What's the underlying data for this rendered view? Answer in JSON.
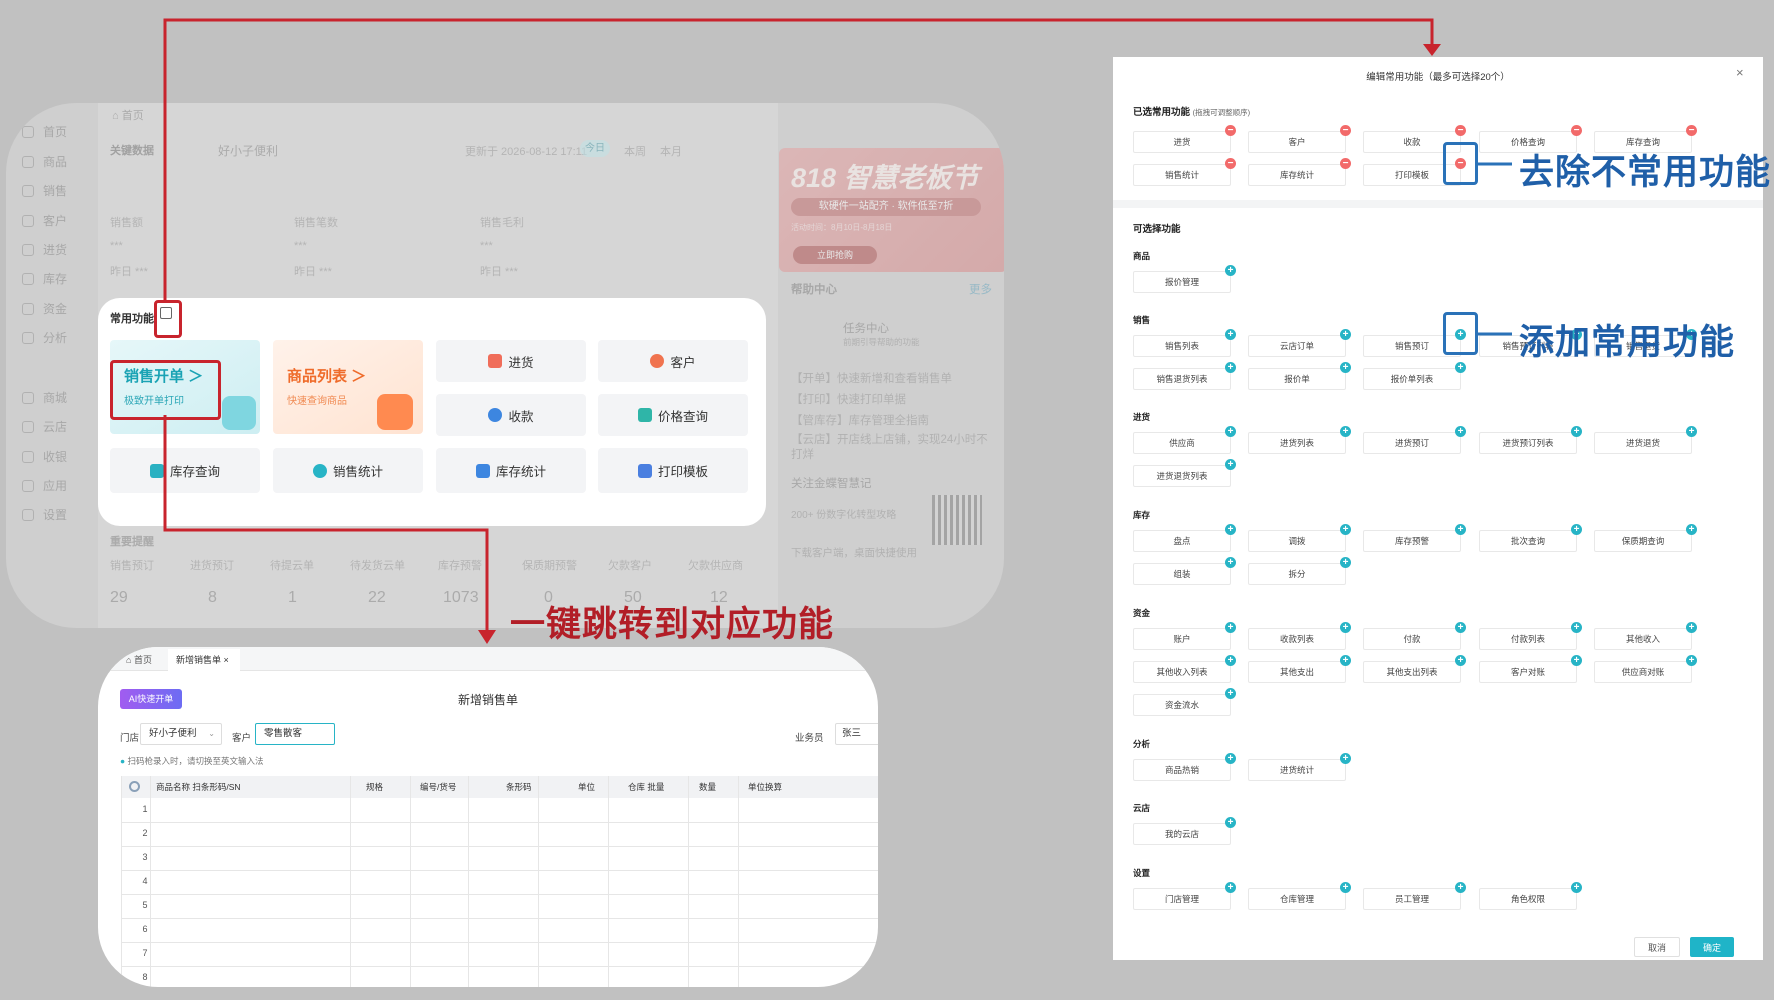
{
  "dashboard": {
    "sidebar": [
      "首页",
      "商品",
      "销售",
      "客户",
      "进货",
      "库存",
      "资金",
      "分析",
      "商城",
      "云店",
      "收银",
      "应用",
      "设置"
    ],
    "tab": "首页",
    "key_label": "关键数据",
    "store": "好小子便利",
    "updated": "更新于 2026-08-12 17:11",
    "periods": [
      "今日",
      "本周",
      "本月"
    ],
    "stats": [
      {
        "label": "销售额",
        "value": "***",
        "yesterday": "昨日 ***"
      },
      {
        "label": "销售笔数",
        "value": "***",
        "yesterday": "昨日 ***"
      },
      {
        "label": "销售毛利",
        "value": "***",
        "yesterday": "昨日 ***"
      }
    ],
    "banner": {
      "title": "818 智慧老板节",
      "line": "软硬件一站配齐 · 软件低至7折",
      "time": "活动时间：8月10日-8月18日",
      "cta": "立即抢购"
    },
    "help": {
      "title": "帮助中心",
      "more": "更多",
      "task": "任务中心",
      "task_sub": "前期引导帮助的功能",
      "tips": [
        "【开单】快速新增和查看销售单",
        "【打印】快速打印单据",
        "【管库存】库存管理全指南",
        "【云店】开店线上店铺，实现24小时不打烊"
      ],
      "follow": "关注金蝶智慧记",
      "follow_sub": "200+ 份数字化转型攻略",
      "download": "下载客户端，桌面快捷使用"
    },
    "reminders_label": "重要提醒",
    "reminders": [
      {
        "label": "销售预订",
        "value": "29"
      },
      {
        "label": "进货预订",
        "value": "8"
      },
      {
        "label": "待提云单",
        "value": "1"
      },
      {
        "label": "待发货云单",
        "value": "22"
      },
      {
        "label": "库存预警",
        "value": "1073"
      },
      {
        "label": "保质期预警",
        "value": "0"
      },
      {
        "label": "欠款客户",
        "value": "50"
      },
      {
        "label": "欠款供应商",
        "value": "12"
      }
    ]
  },
  "quick": {
    "title": "常用功能",
    "sales": {
      "title": "销售开单 ＞",
      "sub": "极致开单打印"
    },
    "goods": {
      "title": "商品列表 ＞",
      "sub": "快速查询商品"
    },
    "tiles": [
      "进货",
      "客户",
      "收款",
      "价格查询",
      "库存查询",
      "销售统计",
      "库存统计",
      "打印模板"
    ]
  },
  "sale": {
    "tabs": [
      "首页",
      "新增销售单"
    ],
    "ai_btn": "AI快速开单",
    "title": "新增销售单",
    "store_label": "门店",
    "store_value": "好小子便利",
    "cust_label": "客户",
    "cust_value": "零售散客",
    "staff_label": "业务员",
    "staff_value": "张三",
    "hint": "扫码枪录入时，请切换至英文输入法",
    "cols": [
      "商品名称  扫条形码/SN",
      "规格",
      "编号/货号",
      "条形码",
      "单位",
      "仓库 批量",
      "数量",
      "单位换算"
    ],
    "rows": [
      "1",
      "2",
      "3",
      "4",
      "5",
      "6",
      "7",
      "8"
    ]
  },
  "modal": {
    "title": "编辑常用功能（最多可选择20个）",
    "selected_title": "已选常用功能",
    "selected_hint": "(拖拽可调整顺序)",
    "selected": [
      "进货",
      "客户",
      "收款",
      "价格查询",
      "库存查询",
      "销售统计",
      "库存统计",
      "打印模板"
    ],
    "available_title": "可选择功能",
    "groups": [
      {
        "name": "商品",
        "items": [
          "报价管理"
        ]
      },
      {
        "name": "销售",
        "items": [
          "销售列表",
          "云店订单",
          "销售预订",
          "销售预订列表",
          "销售退货",
          "销售退货列表",
          "报价单",
          "报价单列表"
        ]
      },
      {
        "name": "进货",
        "items": [
          "供应商",
          "进货列表",
          "进货预订",
          "进货预订列表",
          "进货退货",
          "进货退货列表"
        ]
      },
      {
        "name": "库存",
        "items": [
          "盘点",
          "调拨",
          "库存预警",
          "批次查询",
          "保质期查询",
          "组装",
          "拆分"
        ]
      },
      {
        "name": "资金",
        "items": [
          "账户",
          "收款列表",
          "付款",
          "付款列表",
          "其他收入",
          "其他收入列表",
          "其他支出",
          "其他支出列表",
          "客户对账",
          "供应商对账",
          "资金流水"
        ]
      },
      {
        "name": "分析",
        "items": [
          "商品热销",
          "进货统计"
        ]
      },
      {
        "name": "云店",
        "items": [
          "我的云店"
        ]
      },
      {
        "name": "设置",
        "items": [
          "门店管理",
          "仓库管理",
          "员工管理",
          "角色权限"
        ]
      }
    ],
    "cancel": "取消",
    "ok": "确定"
  },
  "annotations": {
    "remove": "去除不常用功能",
    "add": "添加常用功能",
    "jump": "一键跳转到对应功能"
  },
  "colors": {
    "annotation_red": "#c8242d",
    "annotation_blue": "#2a72b8",
    "accent": "#1fb4c8",
    "remove_badge": "#f26a6a",
    "add_badge": "#27b4c6"
  }
}
